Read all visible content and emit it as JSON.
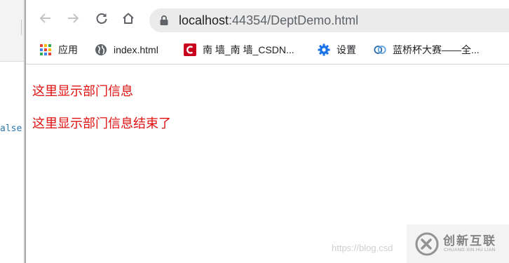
{
  "background_editor": {
    "code_fragment": "alse"
  },
  "browser": {
    "url_host": "localhost",
    "url_path": ":44354/DeptDemo.html",
    "bookmarks": [
      {
        "label": "应用",
        "icon": "apps-grid-icon"
      },
      {
        "label": "index.html",
        "icon": "globe-icon"
      },
      {
        "label": "南 墙_南 墙_CSDN...",
        "icon": "csdn-icon"
      },
      {
        "label": "设置",
        "icon": "gear-icon"
      },
      {
        "label": "蓝桥杯大赛——全...",
        "icon": "lanqiao-icon"
      }
    ]
  },
  "content": {
    "line1": "这里显示部门信息",
    "line2": "这里显示部门信息结束了",
    "text_color": "#e01010"
  },
  "watermark": {
    "url_fragment": "https://blog.csd",
    "brand_cn": "创新互联",
    "brand_en": "CHUANG XIN HU LIAN"
  }
}
